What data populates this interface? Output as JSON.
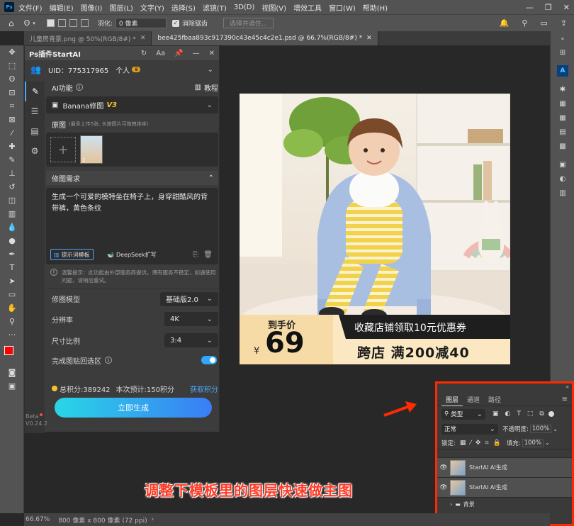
{
  "menu": {
    "items": [
      "文件(F)",
      "编辑(E)",
      "图像(I)",
      "图层(L)",
      "文字(Y)",
      "选择(S)",
      "滤镜(T)",
      "3D(D)",
      "视图(V)",
      "增效工具",
      "窗口(W)",
      "帮助(H)"
    ]
  },
  "options": {
    "feather_label": "羽化:",
    "feather_value": "0 像素",
    "antialias_label": "消除锯齿",
    "select_subject": "选择并遮住..."
  },
  "tabs": [
    {
      "label": "儿童房背景.png @ 50%(RGB/8#) *"
    },
    {
      "label": "bee425fbaa893c917390c43e45c4c2e1.psd @ 66.7%(RGB/8#) *"
    }
  ],
  "plugin": {
    "title": "Ps插件StartAI",
    "uid": "UID：775317965",
    "plan": "个人",
    "ai_feature_label": "AI功能",
    "tutorial": "教程",
    "model_selected": "Banana修图",
    "model_version": "V3",
    "source_label": "原图",
    "source_hint": "(最多上传5张, 长按图片可拖拽排序)",
    "thumb_count": "1",
    "prompt_section": "修图需求",
    "prompt_text": "生成一个可爱的模特坐在椅子上，身穿甜酷风的背带裤，黄色条纹",
    "template_btn": "提示词模板",
    "deepseek_btn": "DeepSeek扩写",
    "warning": "温馨提示：此功能由外部服务商提供，偶有服务不稳定，如遇使用问题，请稍后重试。",
    "model_row_label": "修图模型",
    "model_row_value": "基础版2.0",
    "resolution_label": "分辨率",
    "resolution_value": "4K",
    "ratio_label": "尺寸比例",
    "ratio_value": "3:4",
    "paste_label": "完成图贴回选区",
    "points": "总积分:389242",
    "estimate": "本次预计:150积分",
    "get_points": "获取积分",
    "generate": "立即生成"
  },
  "beta": {
    "tag": "Beta",
    "version": "V0.24.2"
  },
  "poster": {
    "label_price": "到手价",
    "currency": "¥",
    "price": "69",
    "coupon": "收藏店铺领取10元优惠券",
    "promo": "跨店 满200减40"
  },
  "layers": {
    "tabs": [
      "图层",
      "通道",
      "路径"
    ],
    "filter_kind": "类型",
    "blend_mode": "正常",
    "opacity_label": "不透明度:",
    "opacity_value": "100%",
    "lock_label": "锁定:",
    "fill_label": "填充:",
    "fill_value": "100%",
    "items": [
      {
        "name": "StartAI AI生成"
      },
      {
        "name": "StartAI AI生成"
      },
      {
        "name": "背景"
      }
    ]
  },
  "status": {
    "zoom": "66.67%",
    "size": "800 像素 x 800 像素 (72 ppi)"
  },
  "caption": "调整下模板里的图层快速做主图",
  "colors": {
    "accent": "#31a8ff",
    "highlight": "#ff2a00",
    "generate_start": "#28d7e6",
    "generate_end": "#3a7df5"
  }
}
